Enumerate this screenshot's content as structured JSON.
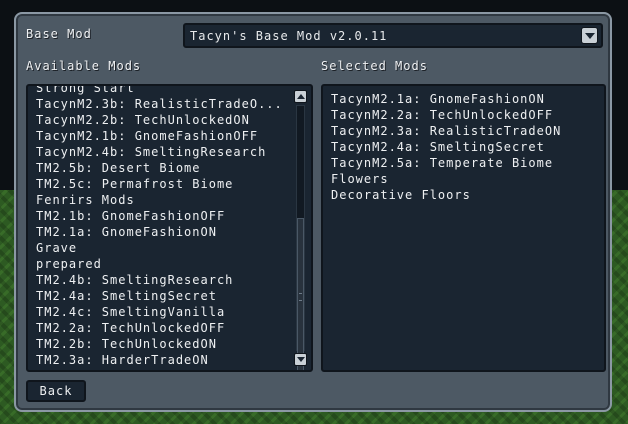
{
  "base_mod": {
    "label": "Base Mod",
    "selected": "Tacyn's Base Mod v2.0.11"
  },
  "available_mods": {
    "label": "Available Mods",
    "items": [
      "Strong Start",
      "TacynM2.3b: RealisticTradeO...",
      "TacynM2.2b: TechUnlockedON",
      "TacynM2.1b: GnomeFashionOFF",
      "TacynM2.4b: SmeltingResearch",
      "TM2.5b: Desert Biome",
      "TM2.5c: Permafrost Biome",
      "Fenrirs Mods",
      "TM2.1b: GnomeFashionOFF",
      "TM2.1a: GnomeFashionON",
      "Grave",
      "prepared",
      "TM2.4b: SmeltingResearch",
      "TM2.4a: SmeltingSecret",
      "TM2.4c: SmeltingVanilla",
      "TM2.2a: TechUnlockedOFF",
      "TM2.2b: TechUnlockedON",
      "TM2.3a: HarderTradeON"
    ]
  },
  "selected_mods": {
    "label": "Selected Mods",
    "items": [
      "TacynM2.1a: GnomeFashionON",
      "TacynM2.2a: TechUnlockedOFF",
      "TacynM2.3a: RealisticTradeON",
      "TacynM2.4a: SmeltingSecret",
      "TacynM2.5a: Temperate Biome",
      "Flowers",
      "Decorative Floors"
    ]
  },
  "back_label": "Back"
}
